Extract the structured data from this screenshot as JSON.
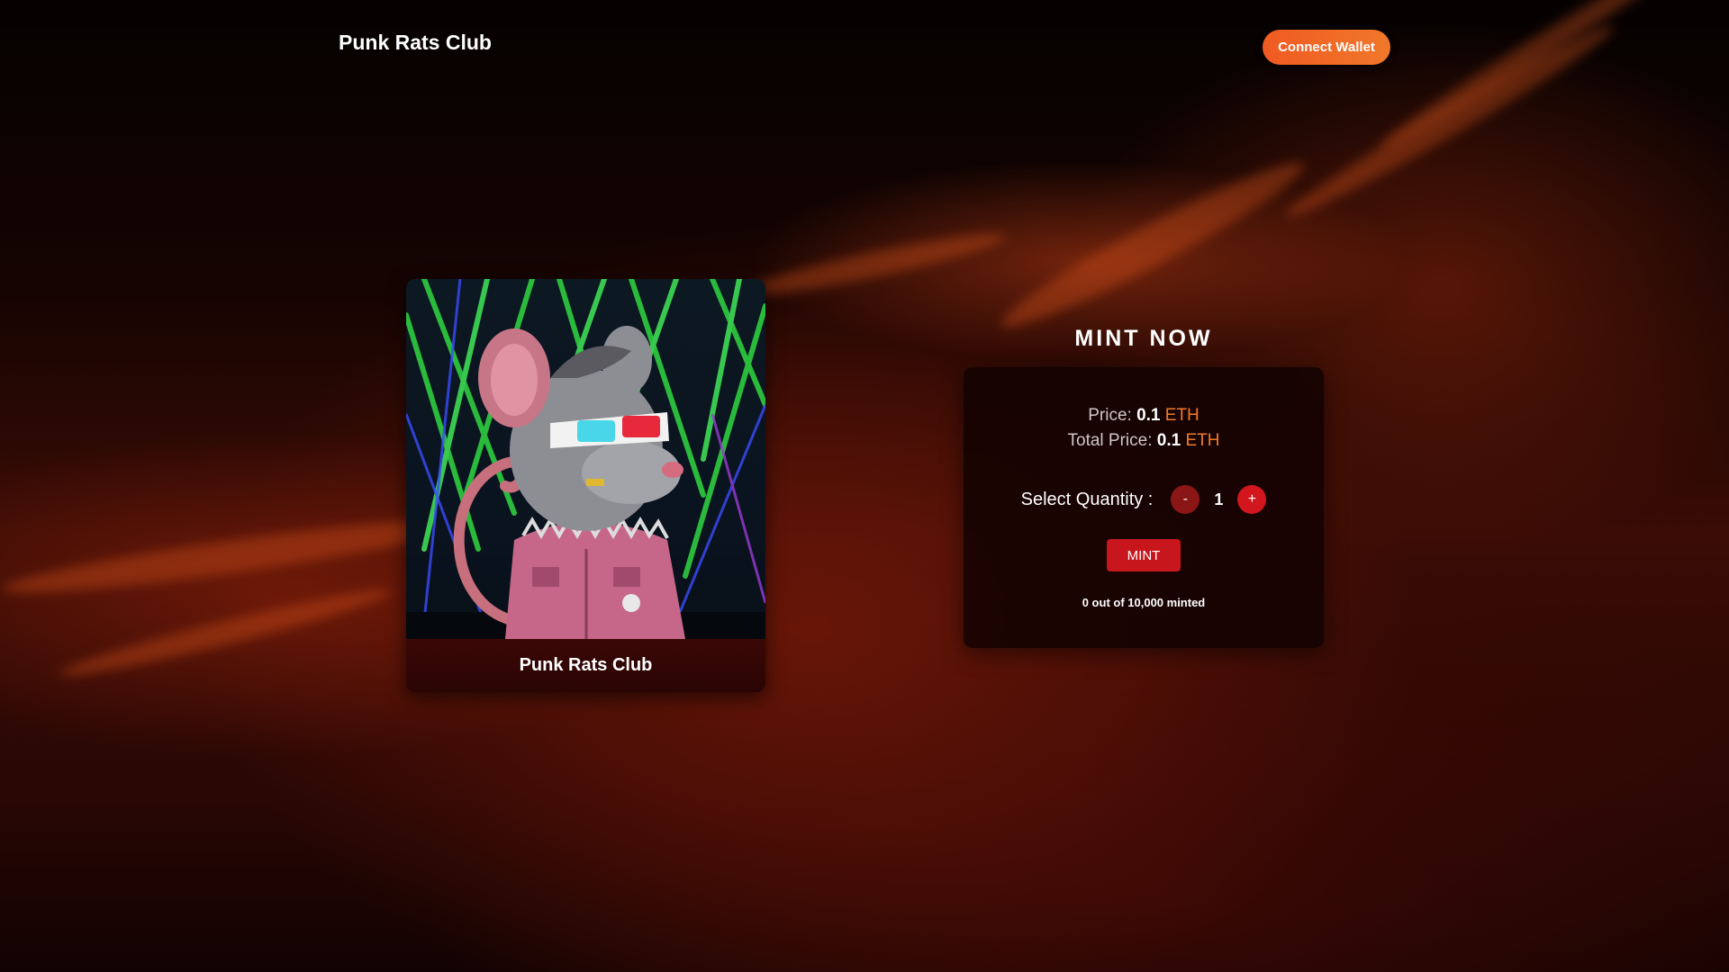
{
  "header": {
    "title": "Punk Rats Club",
    "connect_label": "Connect Wallet"
  },
  "nft": {
    "caption": "Punk Rats Club"
  },
  "mint": {
    "heading": "MINT NOW",
    "price_label": "Price:",
    "price_value": "0.1",
    "price_unit": "ETH",
    "total_label": "Total Price:",
    "total_value": "0.1",
    "total_unit": "ETH",
    "quantity_label": "Select Quantity :",
    "minus_label": "-",
    "quantity_value": "1",
    "plus_label": "+",
    "mint_label": "MINT",
    "minted_text": "0 out of 10,000 minted"
  },
  "colors": {
    "accent": "#f05a22",
    "eth": "#f07a2a",
    "mint_red": "#c8161d"
  }
}
